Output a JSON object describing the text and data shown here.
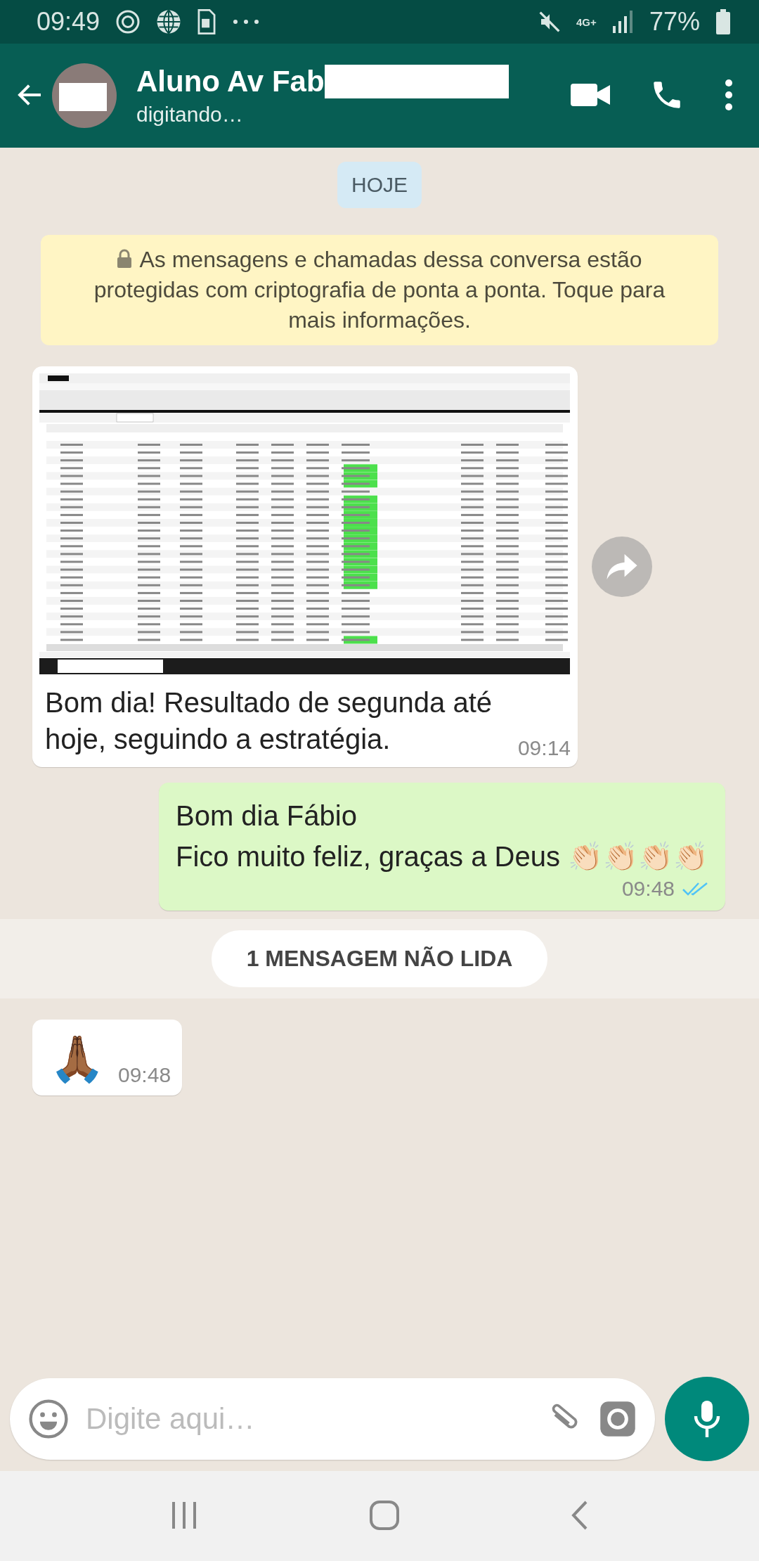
{
  "status_bar": {
    "time": "09:49",
    "network": "4G+",
    "battery": "77%"
  },
  "header": {
    "name": "Aluno Av Fab",
    "status": "digitando…"
  },
  "date_chip": "HOJE",
  "encryption_notice": "As mensagens e chamadas dessa conversa estão protegidas com criptografia de ponta a ponta. Toque para mais informações.",
  "messages": [
    {
      "kind": "image",
      "outgoing": false,
      "caption": "Bom dia! Resultado de segunda até hoje, seguindo a estratégia.",
      "time": "09:14"
    },
    {
      "kind": "text",
      "outgoing": true,
      "lines": [
        "Bom dia Fábio",
        "Fico muito feliz, graças a Deus 👏🏻👏🏻👏🏻👏🏻"
      ],
      "time": "09:48",
      "read": true
    },
    {
      "kind": "divider",
      "label": "1 MENSAGEM NÃO LIDA"
    },
    {
      "kind": "emoji",
      "outgoing": false,
      "lines": [
        "🙏🏾"
      ],
      "time": "09:48"
    }
  ],
  "composer": {
    "placeholder": "Digite aqui…"
  }
}
